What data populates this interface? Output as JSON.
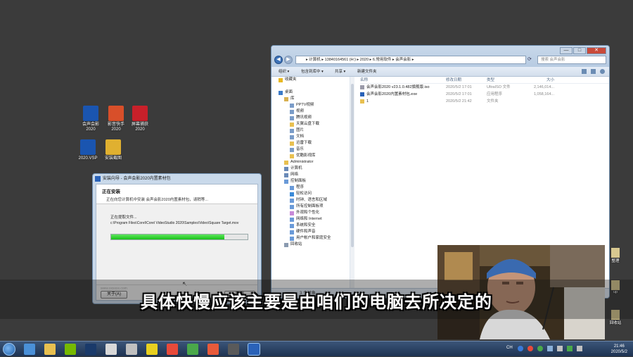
{
  "desktop_icons": [
    {
      "label": "会声会影\n2020",
      "color": "#1a55b0"
    },
    {
      "label": "影音快手\n2020",
      "color": "#d84f2a"
    },
    {
      "label": "屏幕捕获\n2020",
      "color": "#c8202a"
    },
    {
      "label": "2020.VSP",
      "color": "#1a55b0"
    },
    {
      "label": "安装截图",
      "color": "#e0b030"
    }
  ],
  "explorer": {
    "address": "▸ 计算机 ▸ 13840164561 (H:) ▸ 2020 ▸ 6.常用软件 ▸ 会声会影 ▸",
    "search_placeholder": "搜索 会声会影",
    "toolbar": {
      "organize": "组织 ▾",
      "include": "包含到库中 ▾",
      "share": "共享 ▾",
      "new_folder": "新建文件夹"
    },
    "nav": [
      {
        "label": "收藏夹",
        "indent": 0,
        "icon": "star-icon",
        "color": "#e8b820"
      },
      {
        "label": "",
        "indent": 0,
        "icon": "",
        "color": ""
      },
      {
        "label": "桌面",
        "indent": 0,
        "icon": "desktop-icon",
        "color": "#3a7ac8"
      },
      {
        "label": "库",
        "indent": 1,
        "icon": "library-icon",
        "color": "#d8b050"
      },
      {
        "label": "PPTV视频",
        "indent": 2,
        "icon": "video-icon",
        "color": "#7a9cc8"
      },
      {
        "label": "视频",
        "indent": 2,
        "icon": "video-icon",
        "color": "#7a9cc8"
      },
      {
        "label": "腾讯视频",
        "indent": 2,
        "icon": "video-icon",
        "color": "#7a9cc8"
      },
      {
        "label": "天翼云盘下载",
        "indent": 2,
        "icon": "folder-icon",
        "color": "#e8c050"
      },
      {
        "label": "图片",
        "indent": 2,
        "icon": "picture-icon",
        "color": "#7a9cc8"
      },
      {
        "label": "文档",
        "indent": 2,
        "icon": "document-icon",
        "color": "#7a9cc8"
      },
      {
        "label": "迅雷下载",
        "indent": 2,
        "icon": "folder-icon",
        "color": "#e8c050"
      },
      {
        "label": "音乐",
        "indent": 2,
        "icon": "music-icon",
        "color": "#7a9cc8"
      },
      {
        "label": "优酷影视库",
        "indent": 2,
        "icon": "folder-icon",
        "color": "#e8c050"
      },
      {
        "label": "Administrator",
        "indent": 1,
        "icon": "user-icon",
        "color": "#e8c050"
      },
      {
        "label": "计算机",
        "indent": 1,
        "icon": "computer-icon",
        "color": "#6a8ab8"
      },
      {
        "label": "网络",
        "indent": 1,
        "icon": "network-icon",
        "color": "#6a8ab8"
      },
      {
        "label": "控制面板",
        "indent": 1,
        "icon": "control-panel-icon",
        "color": "#6a9ad8"
      },
      {
        "label": "程序",
        "indent": 2,
        "icon": "program-icon",
        "color": "#6a9ad8"
      },
      {
        "label": "轻松访问",
        "indent": 2,
        "icon": "access-icon",
        "color": "#3a8ad8"
      },
      {
        "label": "时钟、语言和区域",
        "indent": 2,
        "icon": "clock-icon",
        "color": "#6a9ad8"
      },
      {
        "label": "所有控制面板项",
        "indent": 2,
        "icon": "control-panel-icon",
        "color": "#6a9ad8"
      },
      {
        "label": "外观和个性化",
        "indent": 2,
        "icon": "appearance-icon",
        "color": "#c88ad8"
      },
      {
        "label": "网络和 Internet",
        "indent": 2,
        "icon": "network-icon",
        "color": "#6a9ad8"
      },
      {
        "label": "系统和安全",
        "indent": 2,
        "icon": "system-icon",
        "color": "#6a9ad8"
      },
      {
        "label": "硬件和声音",
        "indent": 2,
        "icon": "hardware-icon",
        "color": "#6a9ad8"
      },
      {
        "label": "用户帐户和家庭安全",
        "indent": 2,
        "icon": "user-icon",
        "color": "#6a9ad8"
      },
      {
        "label": "回收站",
        "indent": 1,
        "icon": "recycle-bin-icon",
        "color": "#8a9ab0"
      }
    ],
    "columns": {
      "name": "名称",
      "date": "修改日期",
      "type": "类型",
      "size": "大小"
    },
    "files": [
      {
        "name": "会声会影2020 v23.1.0.482旗舰版.iso",
        "date": "2020/5/2 17:01",
        "type": "UltraISO 文件",
        "size": "2,146,014...",
        "color": "#9a9aa8"
      },
      {
        "name": "会声会影2020内置素材包.exe",
        "date": "2020/5/2 17:01",
        "type": "应用程序",
        "size": "1,058,164...",
        "color": "#2a62b8"
      },
      {
        "name": "1",
        "date": "2020/5/2 21:42",
        "type": "文件夹",
        "size": "",
        "color": "#e8c050"
      }
    ],
    "status": "3 个对象"
  },
  "dialog": {
    "title": "安装向导 - 会声会影2020内置素材包",
    "heading": "正在安装",
    "subheading": "正在向您计算机中安装 会声会影2020内置素材包，请稍等...",
    "extract_label": "正在提取文件...",
    "path": "c:\\Program Files\\Corel\\Corel VideoStudio 2020\\Samples\\Video\\Square Target.mov",
    "progress": 0.83,
    "brand": "www.xxxxxx.com",
    "cancel_label": "关于(A)",
    "ok_label": "取消"
  },
  "subtitle": "具体快慢应该主要是由咱们的电脑去所决定的",
  "right_icons": [
    {
      "label": "整理"
    },
    {
      "label": "up"
    },
    {
      "label": "回收站"
    }
  ],
  "taskbar": {
    "apps": [
      {
        "name": "qq-icon",
        "color": "#4a90d8"
      },
      {
        "name": "explorer-icon",
        "color": "#e8c050"
      },
      {
        "name": "nvidia-icon",
        "color": "#76b900"
      },
      {
        "name": "photoshop-icon",
        "color": "#1a3a6a"
      },
      {
        "name": "wechat-icon",
        "color": "#d8d8d8"
      },
      {
        "name": "tools-icon",
        "color": "#c0c0c0"
      },
      {
        "name": "player-icon",
        "color": "#e8d020"
      },
      {
        "name": "chrome-icon",
        "color": "#e84a3a"
      },
      {
        "name": "chrome-alt-icon",
        "color": "#4aa84a"
      },
      {
        "name": "clip-icon",
        "color": "#e85a3a"
      },
      {
        "name": "recorder-icon",
        "color": "#5a5a5a"
      },
      {
        "name": "videostudio-icon",
        "color": "#2a62b8"
      }
    ],
    "time": "21:46",
    "date": "2020/5/2"
  }
}
